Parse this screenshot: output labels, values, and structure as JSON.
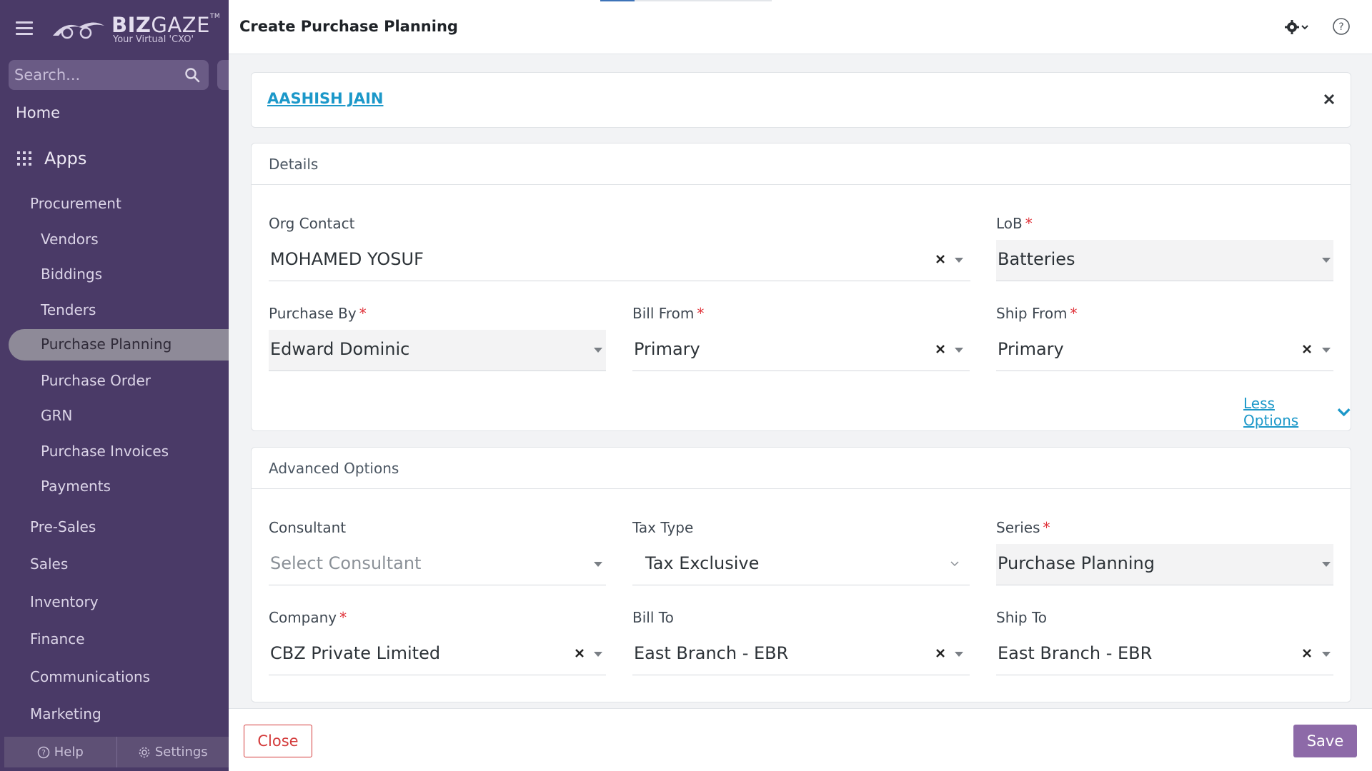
{
  "sidebar": {
    "logo_name_bold": "BIZ",
    "logo_name_rest": "GAZE",
    "logo_tm": "TM",
    "logo_tagline": "Your Virtual 'CXO'",
    "search_placeholder": "Search...",
    "home": "Home",
    "apps": "Apps",
    "procurement": "Procurement",
    "procurement_items": [
      "Vendors",
      "Biddings",
      "Tenders",
      "Purchase Planning",
      "Purchase Order",
      "GRN",
      "Purchase Invoices",
      "Payments"
    ],
    "active_item": "Purchase Planning",
    "sections": [
      "Pre-Sales",
      "Sales",
      "Inventory",
      "Finance",
      "Communications",
      "Marketing"
    ],
    "footer_help": "Help",
    "footer_settings": "Settings"
  },
  "header": {
    "title": "Create Purchase Planning"
  },
  "contact": {
    "name": "AASHISH JAIN"
  },
  "details": {
    "heading": "Details",
    "org_contact_label": "Org Contact",
    "org_contact_value": "MOHAMED YOSUF",
    "lob_label": "LoB",
    "lob_value": "Batteries",
    "purchase_by_label": "Purchase By",
    "purchase_by_value": "Edward Dominic",
    "bill_from_label": "Bill From",
    "bill_from_value": "Primary",
    "ship_from_label": "Ship From",
    "ship_from_value": "Primary",
    "less_options": "Less Options",
    "required_mark": "*"
  },
  "advanced": {
    "heading": "Advanced Options",
    "consultant_label": "Consultant",
    "consultant_placeholder": "Select Consultant",
    "tax_type_label": "Tax Type",
    "tax_type_value": "Tax Exclusive",
    "series_label": "Series",
    "series_value": "Purchase Planning",
    "company_label": "Company",
    "company_value": "CBZ Private Limited",
    "bill_to_label": "Bill To",
    "bill_to_value": "East Branch - EBR",
    "ship_to_label": "Ship To",
    "ship_to_value": "East Branch - EBR"
  },
  "footer": {
    "close_label": "Close",
    "save_label": "Save"
  },
  "colors": {
    "sidebar_bg": "#4a3a67",
    "accent_link": "#1c98c9",
    "save_button": "#8d6aa8",
    "close_button": "#d33a3a",
    "required": "#e0343b"
  }
}
